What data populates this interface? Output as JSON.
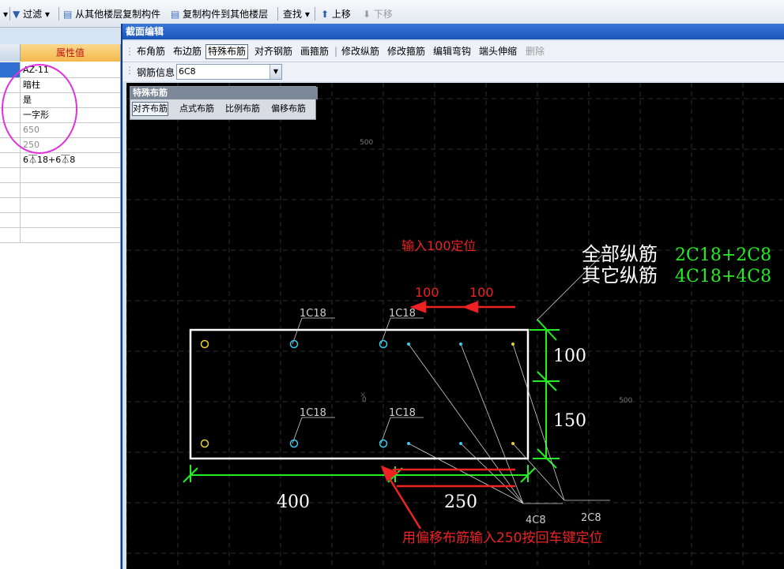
{
  "toolbar": {
    "filter": "过滤",
    "copy_from": "从其他楼层复制构件",
    "copy_to": "复制构件到其他楼层",
    "find": "查找",
    "move_up": "上移",
    "move_down": "下移"
  },
  "property_grid": {
    "header": "属性值",
    "rows": [
      "AZ-11",
      "暗柱",
      "是",
      "一字形",
      "650",
      "250",
      "6⏄18+6⏄8",
      "",
      "",
      "",
      "",
      ""
    ]
  },
  "dialog": {
    "title": "截面编辑",
    "toolbar_items": [
      "布角筋",
      "布边筋",
      "特殊布筋",
      "对齐钢筋",
      "画箍筋",
      "修改纵筋",
      "修改箍筋",
      "编辑弯钩",
      "端头伸缩",
      "删除"
    ],
    "rebar_info_label": "钢筋信息",
    "rebar_info_value": "6C8"
  },
  "special_panel": {
    "title": "特殊布筋",
    "buttons": [
      "对齐布筋",
      "点式布筋",
      "比例布筋",
      "偏移布筋"
    ]
  },
  "drawing": {
    "grid_labels": [
      "500",
      "0",
      "500"
    ],
    "instruction_top": "输入100定位",
    "offset_a": "100",
    "offset_b": "100",
    "all_rebar_label": "全部纵筋",
    "all_rebar_value": "2C18+2C8",
    "other_rebar_label": "其它纵筋",
    "other_rebar_value": "4C18+4C8",
    "bar_labels": [
      "1C18",
      "1C18",
      "1C18",
      "1C18"
    ],
    "dim_100": "100",
    "dim_150": "150",
    "dim_400": "400",
    "dim_250": "250",
    "label_4c8": "4C8",
    "label_2c8": "2C8",
    "instruction_bottom": "用偏移布筋输入250按回车键定位"
  },
  "colors": {
    "green": "#22ee22",
    "red": "#ee2222",
    "white": "#ffffff",
    "cyan": "#33ccee",
    "yellow": "#e8d030",
    "magenta": "#e030e0",
    "grid": "#2a2a2a"
  }
}
